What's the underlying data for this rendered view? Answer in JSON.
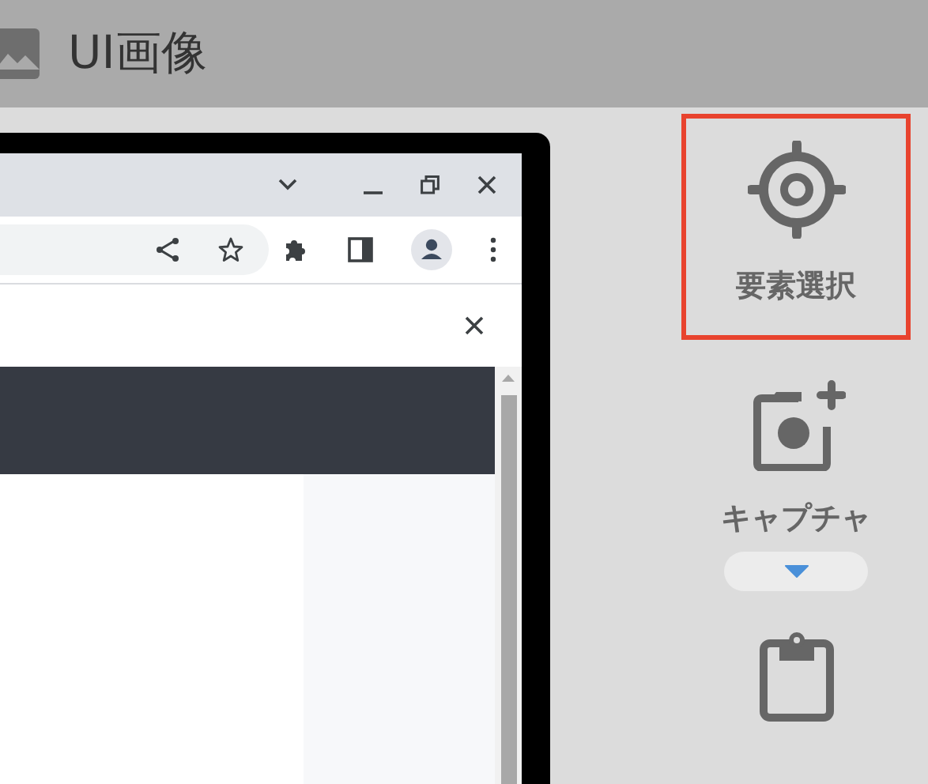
{
  "header": {
    "title": "UI画像"
  },
  "tools": [
    {
      "kind": "target",
      "label": "要素選択",
      "selected": true,
      "menu": false
    },
    {
      "kind": "camera",
      "label": "キャプチャ",
      "selected": false,
      "menu": true
    },
    {
      "kind": "clipboard",
      "selected": false,
      "menu": false
    }
  ]
}
